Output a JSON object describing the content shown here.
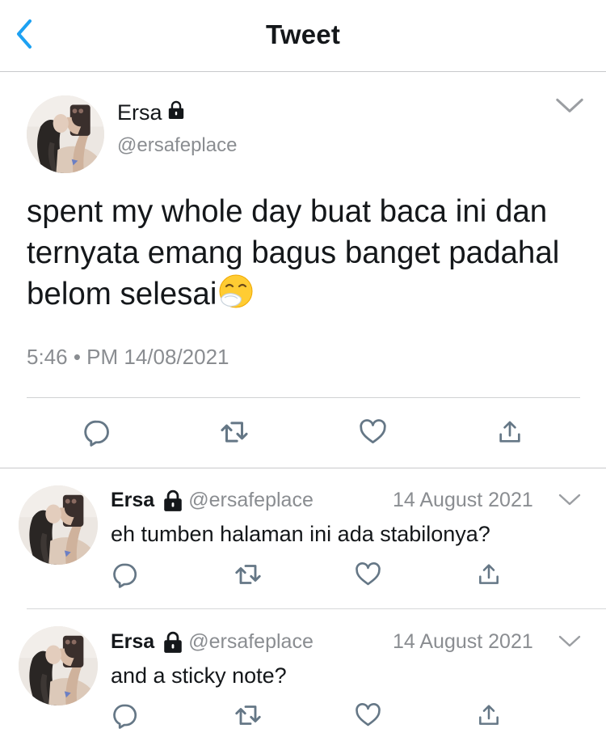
{
  "header": {
    "title": "Tweet",
    "back_icon": "chevron-left-icon",
    "accent_color": "#1da1f2"
  },
  "main_tweet": {
    "name": "Ersa",
    "handle": "@ersafeplace",
    "protected": true,
    "text": "spent my whole day buat baca ini dan ternyata emang bagus banget padahal belom selesai",
    "emoji": "sneezing-face-emoji",
    "time": "5:46 • PM 14/08/2021",
    "actions": [
      "reply-icon",
      "retweet-icon",
      "like-icon",
      "share-icon"
    ]
  },
  "replies": [
    {
      "name": "Ersa",
      "handle": "@ersafeplace",
      "date": "14 August 2021",
      "text": "eh tumben halaman ini ada stabilonya?"
    },
    {
      "name": "Ersa",
      "handle": "@ersafeplace",
      "date": "14 August 2021",
      "text": "and a sticky note?"
    }
  ]
}
